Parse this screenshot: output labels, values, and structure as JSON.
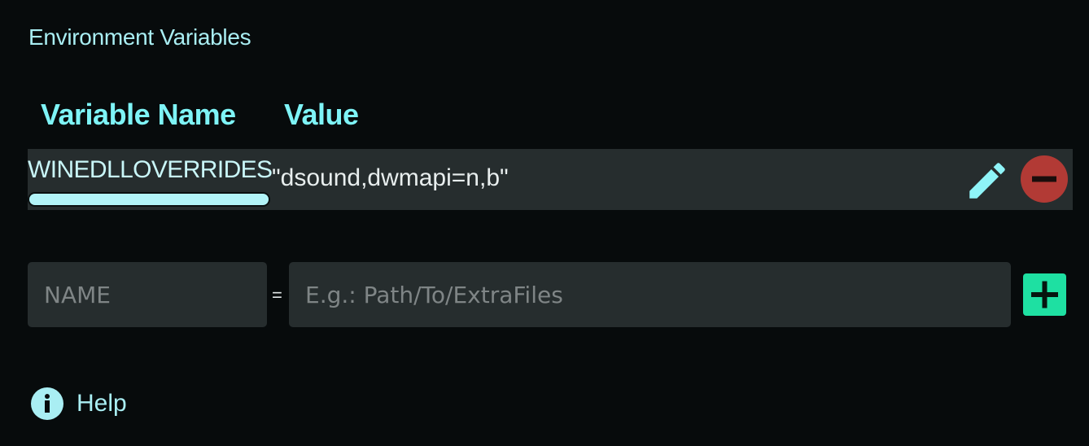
{
  "section": {
    "title": "Environment Variables"
  },
  "table": {
    "headers": {
      "name": "Variable Name",
      "value": "Value"
    },
    "rows": [
      {
        "name": "WINEDLLOVERRIDES",
        "value": "\"dsound,dwmapi=n,b\""
      }
    ]
  },
  "new_variable": {
    "name_placeholder": "NAME",
    "separator": "=",
    "value_placeholder": "E.g.: Path/To/ExtraFiles"
  },
  "help": {
    "label": "Help"
  },
  "icons": {
    "edit": "pencil-icon",
    "remove": "minus-circle-icon",
    "add": "plus-icon",
    "help": "info-icon"
  },
  "colors": {
    "background": "#070b0c",
    "header_text": "#7ef4f7",
    "row_background": "#262d2e",
    "edit_icon": "#8ff4f8",
    "remove_button": "#b23a35",
    "add_button": "#1ee0a2"
  }
}
